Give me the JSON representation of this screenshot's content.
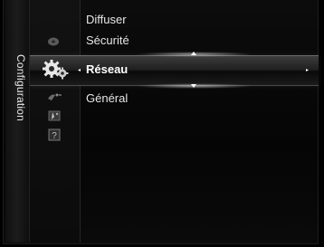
{
  "menu": {
    "side_title": "Configuration",
    "items": [
      {
        "label": "Diffuser"
      },
      {
        "label": "Sécurité"
      },
      {
        "label": "Réseau",
        "selected": true
      },
      {
        "label": "Général"
      }
    ],
    "left_arrow": "◂",
    "right_arrow": "▸"
  },
  "categories": [
    {
      "icon": "disc-icon"
    },
    {
      "icon": "gear-settings-icon",
      "selected": true
    },
    {
      "icon": "satellite-dish-icon"
    },
    {
      "icon": "photo-icon"
    },
    {
      "icon": "help-question-icon"
    }
  ],
  "colors": {
    "text": "#e6e6e6",
    "selected_text": "#ffffff",
    "background": "#000000"
  }
}
